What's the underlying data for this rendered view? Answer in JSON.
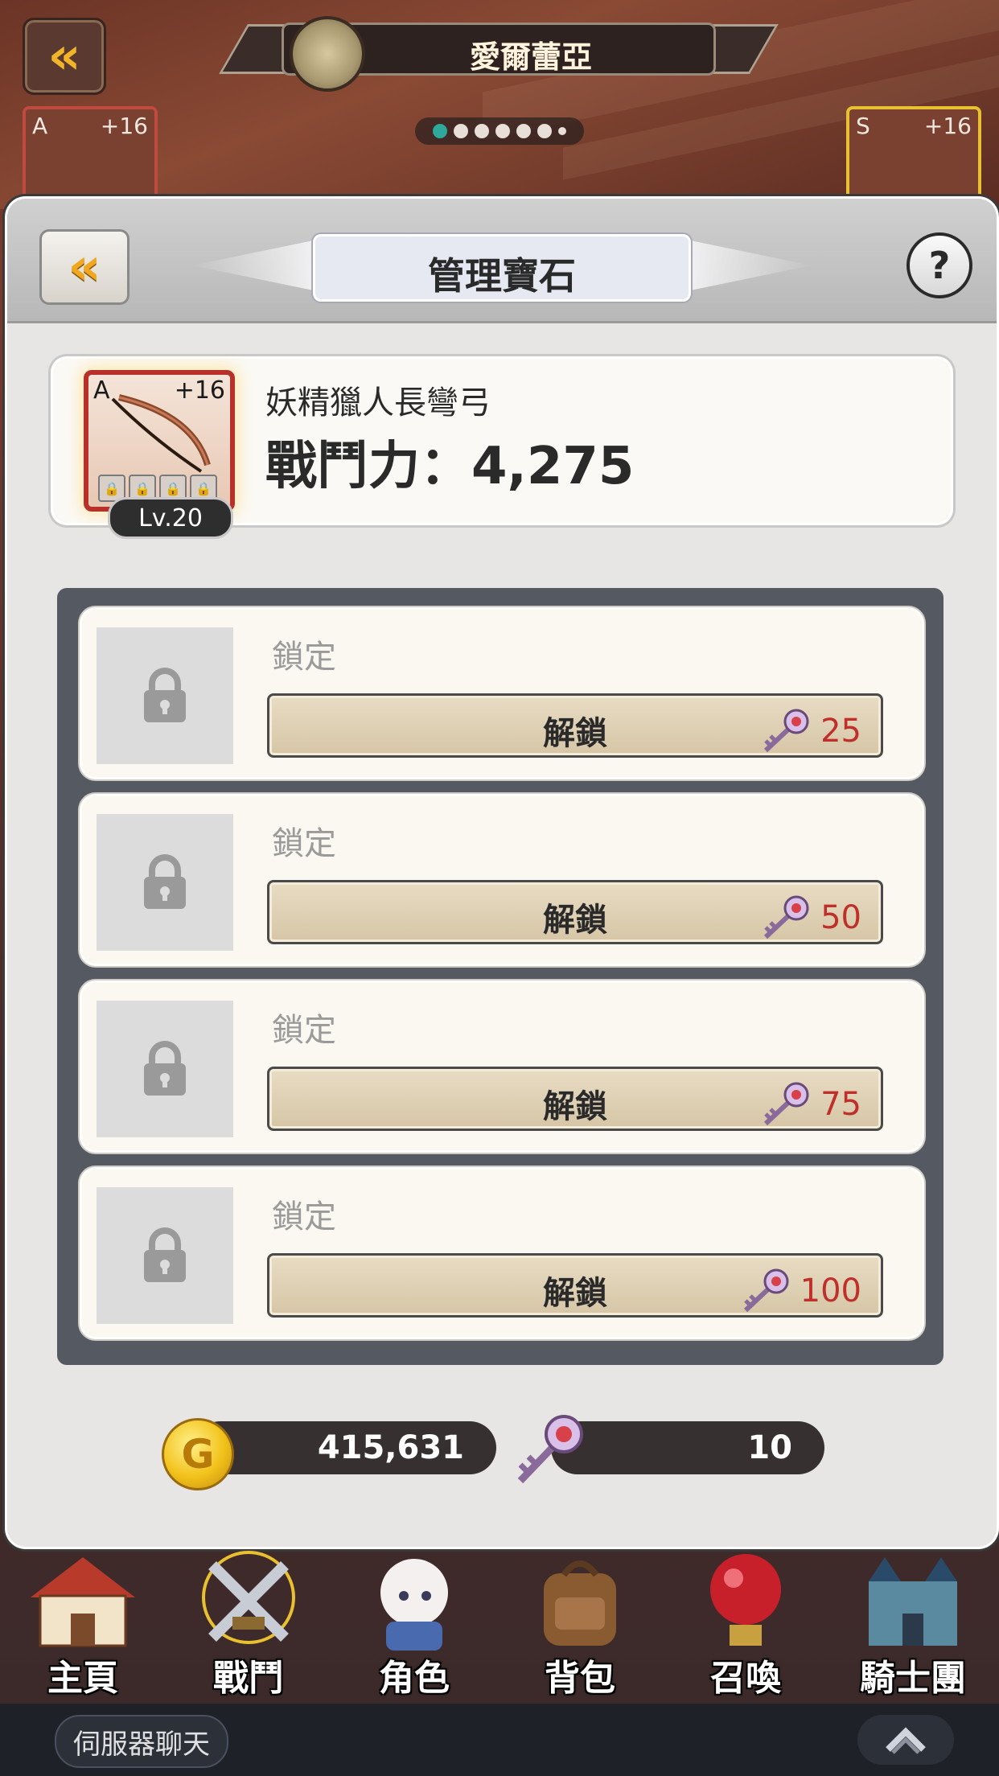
{
  "top": {
    "title": "愛爾蕾亞",
    "pager_dots": 7,
    "pager_active_index": 0
  },
  "background_cards": [
    {
      "grade": "A",
      "plus": "+16"
    },
    {
      "grade": "S",
      "plus": "+16"
    }
  ],
  "modal": {
    "title": "管理寶石",
    "help_label": "?"
  },
  "item": {
    "grade": "A",
    "plus": "+16",
    "level": "Lv.20",
    "name": "妖精獵人長彎弓",
    "power": "戰鬥力：4,275"
  },
  "slots": [
    {
      "label": "鎖定",
      "button": "解鎖",
      "cost": "25"
    },
    {
      "label": "鎖定",
      "button": "解鎖",
      "cost": "50"
    },
    {
      "label": "鎖定",
      "button": "解鎖",
      "cost": "75"
    },
    {
      "label": "鎖定",
      "button": "解鎖",
      "cost": "100"
    }
  ],
  "currency": {
    "gold": "415,631",
    "gold_icon_letter": "G",
    "keys": "10"
  },
  "nav": [
    {
      "label": "主頁",
      "icon": "house-icon"
    },
    {
      "label": "戰鬥",
      "icon": "crossed-swords-icon"
    },
    {
      "label": "角色",
      "icon": "character-icon"
    },
    {
      "label": "背包",
      "icon": "backpack-icon"
    },
    {
      "label": "召喚",
      "icon": "summon-orb-icon"
    },
    {
      "label": "騎士團",
      "icon": "castle-icon"
    }
  ],
  "chat": {
    "label": "伺服器聊天"
  },
  "colors": {
    "cost_red": "#c0302a",
    "pager_active": "#2ea89a",
    "gold": "#f2c21a",
    "panel_dark": "#555a62"
  }
}
